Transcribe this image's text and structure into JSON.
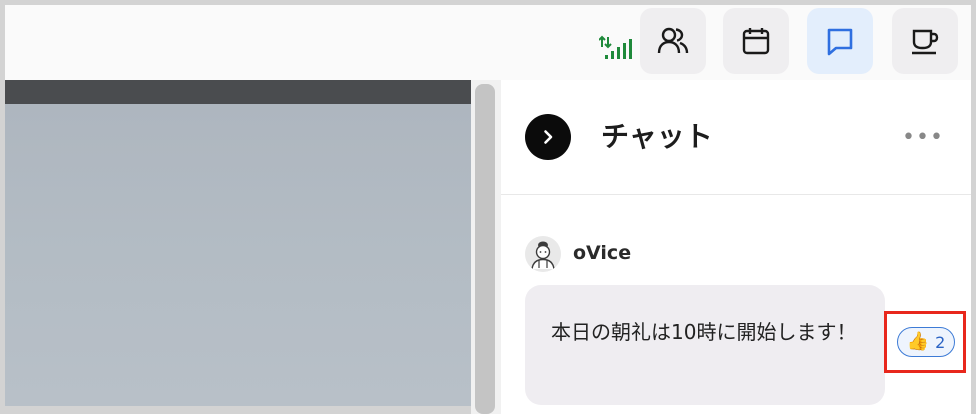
{
  "toolbar": {
    "signal_icon": "signal-strength-icon",
    "buttons": [
      {
        "icon": "people-icon",
        "active": false
      },
      {
        "icon": "calendar-icon",
        "active": false
      },
      {
        "icon": "chat-icon",
        "active": true
      },
      {
        "icon": "coffee-icon",
        "active": false
      }
    ],
    "accent_color": "#2f6fe0",
    "signal_color": "#1f8a3b"
  },
  "chat": {
    "title": "チャット",
    "collapse_icon": "chevron-right-icon",
    "more_icon": "more-horizontal-icon",
    "more_label": "•••",
    "messages": [
      {
        "sender": "oVice",
        "avatar_icon": "avatar-icon",
        "text": "本日の朝礼は10時に開始します！",
        "reaction": {
          "emoji": "👍",
          "count": "2"
        }
      }
    ]
  }
}
